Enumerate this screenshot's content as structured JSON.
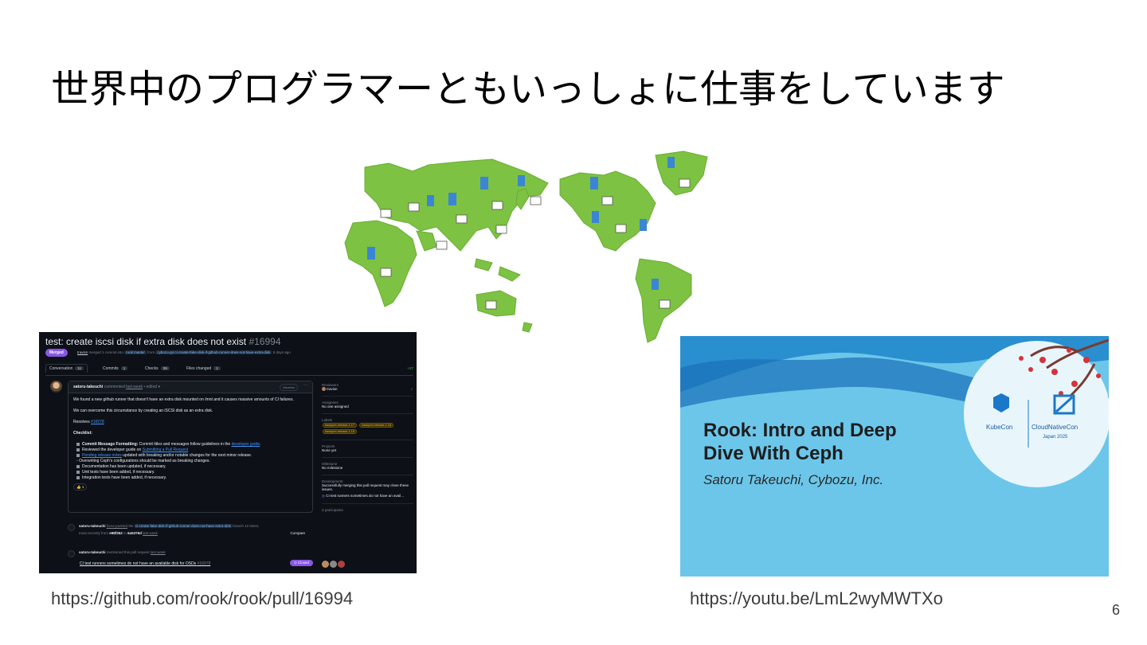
{
  "slide": {
    "title": "世界中のプログラマーともいっしょに仕事をしています",
    "page_number": "6"
  },
  "map": {
    "land_color": "#7dc242"
  },
  "github": {
    "title": "test: create iscsi disk if extra disk does not exist",
    "number": "#16994",
    "status": "Merged",
    "merger": "travisn",
    "merge_text": "merged 1 commit into",
    "base_branch": "rook:master",
    "from_text": "from",
    "head_branch": "cybozu-go:ci-create-fake-disk-if-github-runner-does-not-have-extra-disk",
    "time": "5 days ago",
    "tabs": [
      {
        "label": "Conversation",
        "count": "11"
      },
      {
        "label": "Commits",
        "count": "1"
      },
      {
        "label": "Checks",
        "count": "39"
      },
      {
        "label": "Files changed",
        "count": "1"
      }
    ],
    "diffstat": "+27",
    "comment_author": "satoru-takeuchi",
    "comment_meta": "commented",
    "comment_time": "last week",
    "comment_edited": "• edited ▾",
    "member_badge": "Member",
    "dots": "···",
    "body_p1": "We found a new github runner that doesn't have an extra disk mounted on /mnt and it causes massive amounts of CI failures.",
    "body_p2": "We can overcome this circumstance by creating an iSCSI disk as an extra disk.",
    "resolves_label": "Resolves",
    "resolves_link": "#16978",
    "checklist_label": "Checklist:",
    "checklist": [
      {
        "bold": "Commit Message Formatting:",
        "text": " Commit titles and messages follow guidelines in the ",
        "link": "developer guide",
        "tail": "."
      },
      {
        "bold": "",
        "text": "Reviewed the developer guide on ",
        "link": "Submitting a Pull Request",
        "tail": ""
      },
      {
        "bold": "",
        "text": "",
        "link": "Pending release notes",
        "tail": " updated with breaking and/or notable changes for the next minor release."
      },
      {
        "bold": "",
        "text": "    ◦ Overwriting Ceph's configurations should be marked as breaking changes.",
        "link": "",
        "tail": ""
      },
      {
        "bold": "",
        "text": "Documentation has been updated, if necessary.",
        "link": "",
        "tail": ""
      },
      {
        "bold": "",
        "text": "Unit tests have been added, if necessary.",
        "link": "",
        "tail": ""
      },
      {
        "bold": "",
        "text": "Integration tests have been added, if necessary.",
        "link": "",
        "tail": ""
      }
    ],
    "reaction": "👍 1",
    "sidebar": {
      "reviewers_h": "Reviewers",
      "reviewer": "travisn",
      "assignees_h": "Assignees",
      "assignees_v": "No one assigned",
      "labels_h": "Labels",
      "labels": [
        "backport-release-1.17",
        "backport-release-1.18",
        "backport-release-1.19"
      ],
      "projects_h": "Projects",
      "projects_v": "None yet",
      "milestone_h": "Milestone",
      "milestone_v": "No milestone",
      "development_h": "Development",
      "development_v": "Successfully merging this pull request may close these issues.",
      "development_issue": "CI test runners sometimes do not have an avail...",
      "participants_h": "3 participants"
    },
    "event1_author": "satoru-takeuchi",
    "event1_action": "force-pushed",
    "event1_the": "the",
    "event1_branch": "ci-create-fake-disk-if-github-runner-does-not-have-extra-disk",
    "event1_tail": "branch 12 times,",
    "event1_line2": "most recently from",
    "event1_from": "e98f352",
    "event1_to_text": "to",
    "event1_to": "6a5376d",
    "event1_time": "last week",
    "event1_compare": "Compare",
    "event2_author": "satoru-takeuchi",
    "event2_text": "mentioned this pull request",
    "event2_time": "last week",
    "event2_link": "CI test runners sometimes do not have an available disk for OSDs",
    "event2_num": "#16978",
    "event2_state": "Closed"
  },
  "youtube": {
    "title": "Rook: Intro and Deep\nDive With Ceph",
    "author": "Satoru Takeuchi, Cybozu, Inc.",
    "logo1": "KubeCon",
    "logo2": "CloudNativeCon",
    "logo_sub": "Japan 2025"
  },
  "captions": {
    "github_url": "https://github.com/rook/rook/pull/16994",
    "youtube_url": "https://youtu.be/LmL2wyMWTXo"
  }
}
